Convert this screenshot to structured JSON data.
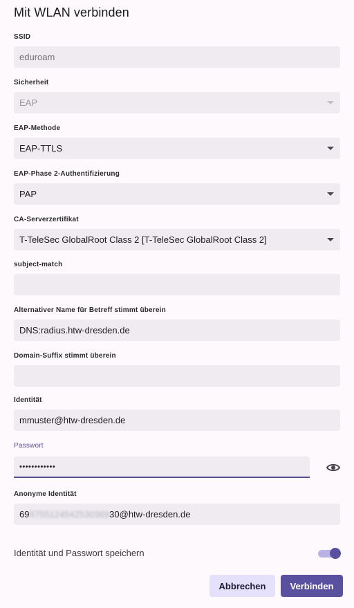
{
  "dialog": {
    "title": "Mit WLAN verbinden"
  },
  "fields": {
    "ssid": {
      "label": "SSID",
      "value": "eduroam"
    },
    "security": {
      "label": "Sicherheit",
      "value": "EAP"
    },
    "eap_method": {
      "label": "EAP-Methode",
      "value": "EAP-TTLS"
    },
    "phase2": {
      "label": "EAP-Phase 2-Authentifizierung",
      "value": "PAP"
    },
    "ca_cert": {
      "label": "CA-Serverzertifikat",
      "value": "T-TeleSec GlobalRoot Class 2 [T-TeleSec GlobalRoot Class 2]"
    },
    "subject_match": {
      "label": "subject-match",
      "value": ""
    },
    "alt_name": {
      "label": "Alternativer Name für Betreff stimmt überein",
      "value": "DNS:radius.htw-dresden.de"
    },
    "domain_suffix": {
      "label": "Domain-Suffix stimmt überein",
      "value": ""
    },
    "identity": {
      "label": "Identität",
      "value": "mmuster@htw-dresden.de"
    },
    "password": {
      "label": "Passwort",
      "value": "••••••••••••"
    },
    "anon_identity": {
      "label": "Anonyme Identität",
      "value_prefix": "69",
      "value_hidden": "8755124542530369",
      "value_suffix": "30@htw-dresden.de"
    }
  },
  "save_credentials": {
    "label": "Identität und Passwort speichern",
    "enabled": true
  },
  "buttons": {
    "cancel": "Abbrechen",
    "connect": "Verbinden"
  },
  "icons": {
    "password_toggle": "eye-icon",
    "dropdown": "chevron-down-icon"
  },
  "colors": {
    "accent": "#5a50a0",
    "field_bg": "#efebf1",
    "background": "#fdf9fc"
  }
}
